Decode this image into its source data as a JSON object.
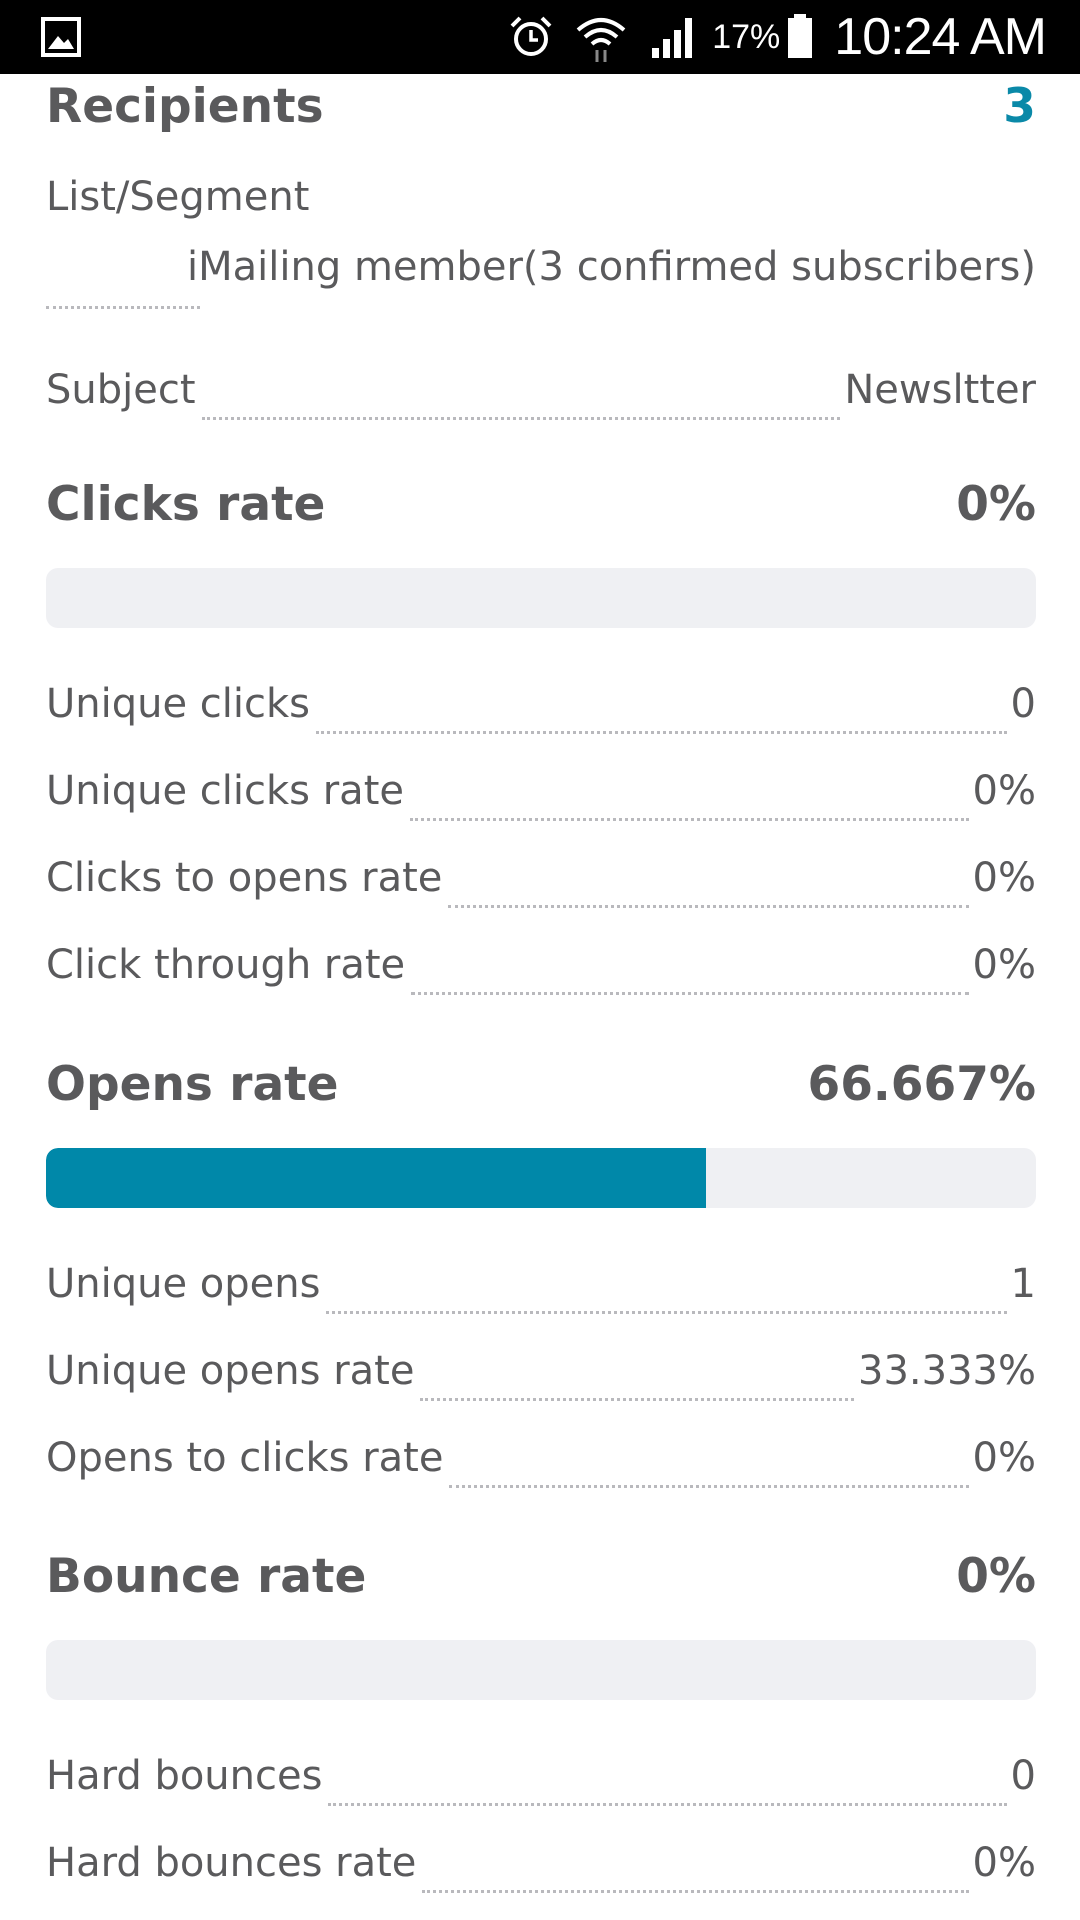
{
  "status_bar": {
    "battery_percent": "17%",
    "time": "10:24 AM",
    "icons": [
      "image-icon",
      "alarm-icon",
      "wifi-icon",
      "signal-icon",
      "battery-icon"
    ]
  },
  "recipients": {
    "label": "Recipients",
    "value": "3"
  },
  "list_segment": {
    "label": "List/Segment",
    "value": "iMailing member(3 confirmed subscribers)"
  },
  "subject": {
    "label": "Subject",
    "value": "Newsltter"
  },
  "clicks": {
    "title": "Clicks rate",
    "value": "0%",
    "progress_fraction": 0,
    "rows": [
      {
        "label": "Unique clicks",
        "value": "0"
      },
      {
        "label": "Unique clicks rate",
        "value": "0%"
      },
      {
        "label": "Clicks to opens rate",
        "value": "0%"
      },
      {
        "label": "Click through rate",
        "value": "0%"
      }
    ]
  },
  "opens": {
    "title": "Opens rate",
    "value": "66.667%",
    "progress_fraction": 0.66667,
    "rows": [
      {
        "label": "Unique opens",
        "value": "1"
      },
      {
        "label": "Unique opens rate",
        "value": "33.333%"
      },
      {
        "label": "Opens to clicks rate",
        "value": "0%"
      }
    ]
  },
  "bounce": {
    "title": "Bounce rate",
    "value": "0%",
    "progress_fraction": 0,
    "rows": [
      {
        "label": "Hard bounces",
        "value": "0"
      },
      {
        "label": "Hard bounces rate",
        "value": "0%"
      }
    ]
  },
  "colors": {
    "accent": "#0088a9",
    "text": "#5a5a5c",
    "track": "#eff0f3"
  }
}
